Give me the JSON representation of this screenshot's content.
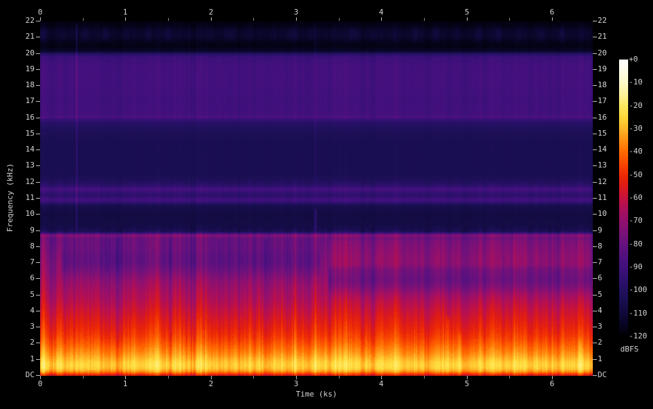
{
  "figure": {
    "background": "#000000",
    "text_color": "#d4d4d4",
    "tick_color": "#c0c0c0",
    "minor_tick_color": "#8a8a8a"
  },
  "chart_data": {
    "type": "heatmap",
    "subtype": "audio-spectrogram",
    "title": "",
    "xlabel": "Time (ks)",
    "ylabel": "Frequency (kHz)",
    "x_range_ks": [
      0,
      6.47
    ],
    "x_major_ticks": [
      0,
      1,
      2,
      3,
      4,
      5,
      6
    ],
    "x_major_tick_labels": [
      "0",
      "1",
      "2",
      "3",
      "4",
      "5",
      "6"
    ],
    "x_minor_tick_step_ks": 0.5,
    "y_range_khz": [
      0,
      22
    ],
    "y_tick_labels_top_to_bottom": [
      "22",
      "21",
      "20",
      "19",
      "18",
      "17",
      "16",
      "15",
      "14",
      "13",
      "12",
      "11",
      "10",
      "9",
      "8",
      "7",
      "6",
      "5",
      "4",
      "3",
      "2",
      "1",
      "DC"
    ],
    "grid": false,
    "colorbar": {
      "label": "dBFS",
      "tick_labels": [
        "+0",
        "-10",
        "-20",
        "-30",
        "-40",
        "-50",
        "-60",
        "-70",
        "-80",
        "-90",
        "-100",
        "-110",
        "-120"
      ],
      "max_db": 0,
      "min_db": -120,
      "color_stops_db_hex": [
        [
          -120,
          "#000000"
        ],
        [
          -115,
          "#070522"
        ],
        [
          -110,
          "#100a3a"
        ],
        [
          -105,
          "#180e4e"
        ],
        [
          -100,
          "#231060"
        ],
        [
          -95,
          "#301070"
        ],
        [
          -90,
          "#40107c"
        ],
        [
          -85,
          "#521180"
        ],
        [
          -80,
          "#66117e"
        ],
        [
          -75,
          "#7a1178"
        ],
        [
          -70,
          "#92106e"
        ],
        [
          -65,
          "#ab0f5c"
        ],
        [
          -60,
          "#c51240"
        ],
        [
          -55,
          "#dc1a1a"
        ],
        [
          -50,
          "#ee2a04"
        ],
        [
          -45,
          "#f94902"
        ],
        [
          -40,
          "#ff6a00"
        ],
        [
          -35,
          "#ff9013"
        ],
        [
          -30,
          "#ffb627"
        ],
        [
          -25,
          "#ffd93a"
        ],
        [
          -20,
          "#ffe95e"
        ],
        [
          -15,
          "#fff39a"
        ],
        [
          -10,
          "#fff9c8"
        ],
        [
          -5,
          "#fffce8"
        ],
        [
          0,
          "#ffffff"
        ]
      ]
    },
    "frequency_profile_dbfs": [
      [
        0.0,
        -54
      ],
      [
        0.05,
        -51
      ],
      [
        0.12,
        -44
      ],
      [
        0.2,
        -37
      ],
      [
        0.3,
        -31
      ],
      [
        0.42,
        -27
      ],
      [
        0.6,
        -25
      ],
      [
        0.8,
        -26
      ],
      [
        1.0,
        -29
      ],
      [
        1.25,
        -33
      ],
      [
        1.55,
        -37
      ],
      [
        1.95,
        -42
      ],
      [
        2.4,
        -47
      ],
      [
        2.9,
        -51
      ],
      [
        3.5,
        -55
      ],
      [
        4.1,
        -59
      ],
      [
        4.7,
        -63
      ],
      [
        5.3,
        -66
      ],
      [
        5.9,
        -69
      ],
      [
        6.5,
        -72
      ],
      [
        7.1,
        -74
      ],
      [
        7.7,
        -76
      ],
      [
        8.2,
        -78
      ],
      [
        8.5,
        -79
      ],
      [
        8.62,
        -74
      ],
      [
        8.72,
        -73
      ],
      [
        8.82,
        -90
      ],
      [
        8.95,
        -104
      ],
      [
        9.3,
        -107
      ],
      [
        10.0,
        -108
      ],
      [
        10.55,
        -105
      ],
      [
        10.75,
        -94
      ],
      [
        10.9,
        -89
      ],
      [
        11.05,
        -93
      ],
      [
        11.2,
        -97
      ],
      [
        11.4,
        -92
      ],
      [
        11.55,
        -88
      ],
      [
        11.72,
        -94
      ],
      [
        11.92,
        -99
      ],
      [
        12.15,
        -102
      ],
      [
        12.5,
        -104
      ],
      [
        13.5,
        -104
      ],
      [
        14.5,
        -104
      ],
      [
        15.2,
        -102
      ],
      [
        15.7,
        -98
      ],
      [
        15.92,
        -92
      ],
      [
        16.02,
        -86
      ],
      [
        16.15,
        -89
      ],
      [
        17.0,
        -90
      ],
      [
        18.0,
        -89
      ],
      [
        19.2,
        -89
      ],
      [
        19.75,
        -91
      ],
      [
        19.98,
        -100
      ],
      [
        20.12,
        -113
      ],
      [
        20.4,
        -117
      ],
      [
        20.7,
        -116
      ],
      [
        21.0,
        -113
      ],
      [
        21.35,
        -113
      ],
      [
        21.65,
        -116
      ],
      [
        22.0,
        -118
      ]
    ],
    "spectral_valleys": [
      {
        "t_start": 0.25,
        "t_end": 3.28,
        "center_khz": 7.05,
        "half_width_khz": 0.85,
        "depth_db": 7
      },
      {
        "t_start": 3.38,
        "t_end": 6.47,
        "center_khz": 5.85,
        "half_width_khz": 0.75,
        "depth_db": 9
      }
    ],
    "band_boosts": [
      {
        "t_start": 3.38,
        "t_end": 6.47,
        "f_low_khz": 6.6,
        "f_high_khz": 8.6,
        "boost_db": 4
      }
    ],
    "transient_events": [
      {
        "t_ks": 0.035,
        "half_width_ks": 0.025,
        "boost_db": 4,
        "f_top_khz": 8.7
      },
      {
        "t_ks": 0.425,
        "half_width_ks": 0.01,
        "boost_db": 9,
        "f_top_khz": 22,
        "f_bottom_khz": 8.8
      },
      {
        "t_ks": 3.225,
        "half_width_ks": 0.014,
        "boost_db": 13,
        "f_top_khz": 10.55
      },
      {
        "t_ks": 3.225,
        "half_width_ks": 0.01,
        "boost_db": 5,
        "f_top_khz": 22,
        "f_bottom_khz": 10.6
      },
      {
        "t_ks": 4.78,
        "half_width_ks": 0.025,
        "boost_db": 7,
        "f_top_khz": 3.8
      },
      {
        "t_ks": 4.92,
        "half_width_ks": 0.018,
        "boost_db": 5,
        "f_top_khz": 2.8
      },
      {
        "t_ks": 6.33,
        "half_width_ks": 0.018,
        "boost_db": 5,
        "f_top_khz": 2.5
      },
      {
        "t_ks": 1.34,
        "half_width_ks": 0.045,
        "boost_db": 3.5,
        "f_top_khz": 8.7
      },
      {
        "t_ks": 5.55,
        "half_width_ks": 0.02,
        "boost_db": 3,
        "f_top_khz": 8.7
      },
      {
        "t_ks": 0.9,
        "half_width_ks": 0.018,
        "boost_db": -5,
        "f_top_khz": 8.7
      },
      {
        "t_ks": 1.52,
        "half_width_ks": 0.016,
        "boost_db": -6,
        "f_top_khz": 8.7
      },
      {
        "t_ks": 2.1,
        "half_width_ks": 0.022,
        "boost_db": -5,
        "f_top_khz": 8.7
      },
      {
        "t_ks": 2.64,
        "half_width_ks": 0.02,
        "boost_db": -5,
        "f_top_khz": 8.7
      }
    ],
    "texture": {
      "column_noise_db": 3.2,
      "column_noise_persistence": 0.72,
      "column_spike_probability": 0.025,
      "pixel_noise_db": 1.6,
      "random_seed": 1234,
      "blob_band": {
        "f_low_khz": 20.7,
        "f_high_khz": 21.7,
        "center_khz": 21.2,
        "amplitude_db": 2.6
      }
    }
  }
}
